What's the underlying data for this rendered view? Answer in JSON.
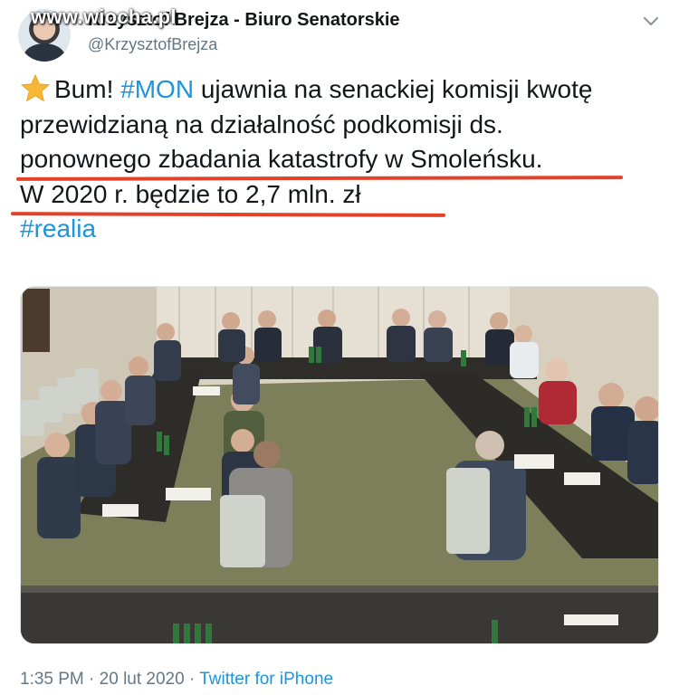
{
  "watermark": "www.wiocha.pl",
  "author": {
    "display_name": "Krzysztof Brejza - Biuro Senatorskie",
    "handle": "@KrzysztofBrejza"
  },
  "tweet": {
    "line1_text": "Bum! ",
    "line1_hashtag": "#MON",
    "line1_rest": " ujawnia na senackiej komisji kwotę",
    "line2": "przewidzianą na działalność podkomisji ds.",
    "line3": "ponownego zbadania katastrofy w Smoleńsku.",
    "line4": "W 2020 r. będzie to 2,7 mln. zł",
    "hashtag2": "#realia"
  },
  "meta": {
    "time": "1:35 PM",
    "separator": "·",
    "date": "20 lut 2020",
    "source": "Twitter for iPhone"
  },
  "colors": {
    "link": "#1b95e0",
    "underline": "#e2412a",
    "muted": "#657786",
    "star": "#f5b735"
  },
  "icons": {
    "star": "star-emoji-icon",
    "caret": "chevron-down-icon"
  }
}
